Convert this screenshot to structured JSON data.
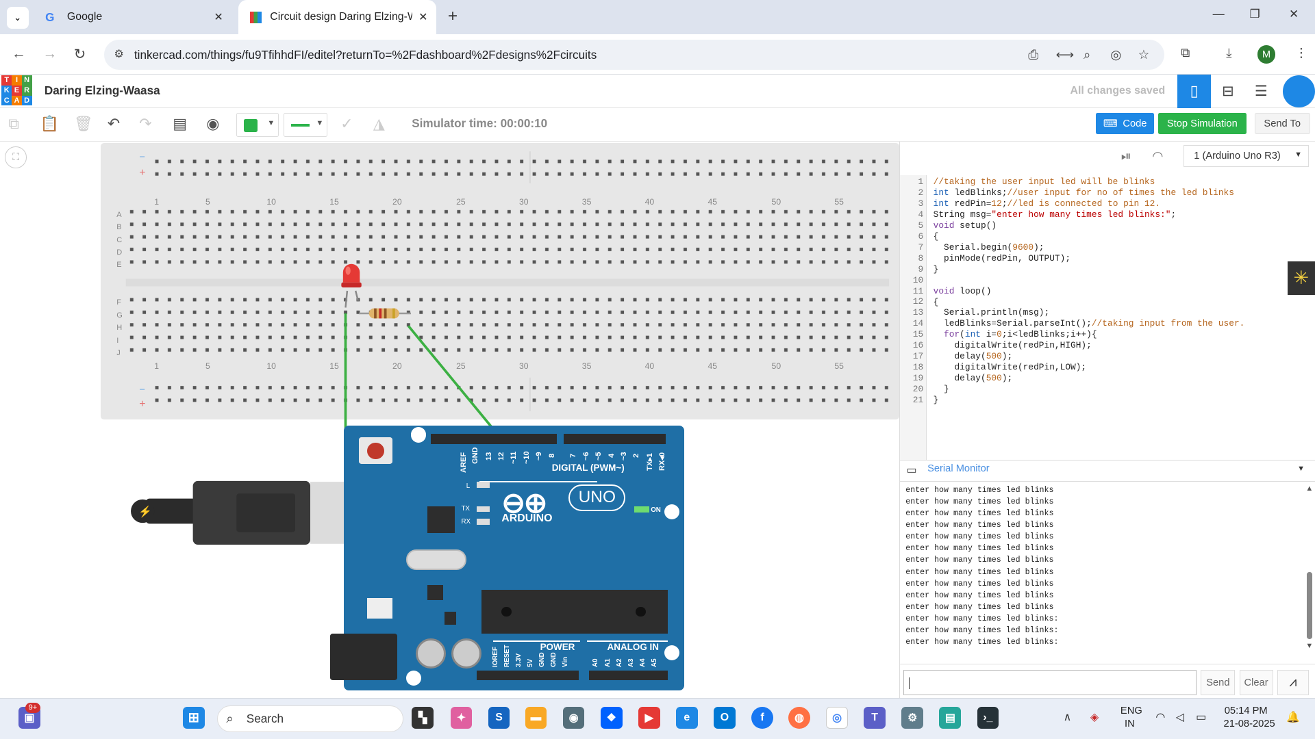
{
  "browser": {
    "tabs": [
      {
        "label": "Google"
      },
      {
        "label": "Circuit design Daring Elzing-Wa"
      }
    ],
    "url": "tinkercad.com/things/fu9TfihhdFI/editel?returnTo=%2Fdashboard%2Fdesigns%2Fcircuits",
    "profile_initial": "M"
  },
  "app": {
    "logo_letters": [
      "T",
      "I",
      "N",
      "K",
      "E",
      "R",
      "C",
      "A",
      "D"
    ],
    "title": "Daring Elzing-Waasa",
    "save_status": "All changes saved"
  },
  "toolbar": {
    "sim_time": "Simulator time: 00:00:10",
    "code_label": "Code",
    "stop_label": "Stop Simulation",
    "send_to_label": "Send To"
  },
  "code_panel": {
    "device": "1 (Arduino Uno R3)",
    "line_numbers": [
      "1",
      "2",
      "3",
      "4",
      "5",
      "6",
      "7",
      "8",
      "9",
      "10",
      "11",
      "12",
      "13",
      "14",
      "15",
      "16",
      "17",
      "18",
      "19",
      "20",
      "21"
    ],
    "lines": [
      "//taking the user input led will be blinks",
      "int ledBlinks;//user input for no of times the led blinks",
      "int redPin=12;//led is connected to pin 12.",
      "String msg=\"enter how many times led blinks:\";",
      "void setup()",
      "{",
      "  Serial.begin(9600);",
      "  pinMode(redPin, OUTPUT);",
      "}",
      "",
      "void loop()",
      "{",
      "  Serial.println(msg);",
      "  ledBlinks=Serial.parseInt();//taking input from the user.",
      "  for(int i=0;i<ledBlinks;i++){",
      "    digitalWrite(redPin,HIGH);",
      "    delay(500);",
      "    digitalWrite(redPin,LOW);",
      "    delay(500);",
      "  }",
      "}"
    ]
  },
  "serial_monitor": {
    "title": "Serial Monitor",
    "lines": [
      "enter how many times led blinks",
      "enter how many times led blinks",
      "enter how many times led blinks",
      "enter how many times led blinks",
      "enter how many times led blinks",
      "enter how many times led blinks",
      "enter how many times led blinks",
      "enter how many times led blinks",
      "enter how many times led blinks",
      "enter how many times led blinks",
      "enter how many times led blinks",
      "enter how many times led blinks:",
      "enter how many times led blinks:",
      "enter how many times led blinks:"
    ],
    "send_label": "Send",
    "clear_label": "Clear"
  },
  "breadboard": {
    "top_numbers": [
      "1",
      "5",
      "10",
      "15",
      "20",
      "25",
      "30",
      "35",
      "40",
      "45",
      "50",
      "55"
    ],
    "rows_top": [
      "A",
      "B",
      "C",
      "D",
      "E"
    ],
    "rows_bottom": [
      "F",
      "G",
      "H",
      "I",
      "J"
    ],
    "rail_minus": "−",
    "rail_plus": "+"
  },
  "arduino": {
    "brand": "ARDUINO",
    "model": "UNO",
    "digital_label": "DIGITAL (PWM~)",
    "power_label": "POWER",
    "analog_label": "ANALOG IN",
    "on_label": "ON",
    "l_label": "L",
    "tx_label": "TX",
    "rx_label": "RX",
    "top_pins": [
      "AREF",
      "GND",
      "13",
      "12",
      "~11",
      "~10",
      "~9",
      "8",
      "7",
      "~6",
      "~5",
      "4",
      "~3",
      "2",
      "TX▸1",
      "RX◂0"
    ],
    "bottom_pins": [
      "IOREF",
      "RESET",
      "3.3V",
      "5V",
      "GND",
      "GND",
      "Vin",
      "A0",
      "A1",
      "A2",
      "A3",
      "A4",
      "A5"
    ]
  },
  "taskbar": {
    "search_placeholder": "Search",
    "notification_badge": "9+",
    "lang": "ENG",
    "region": "IN",
    "time": "05:14 PM",
    "date": "21-08-2025"
  },
  "colors": {
    "accent_blue": "#1e88e5",
    "stop_green": "#2bb34a",
    "wire_green": "#3cb043",
    "arduino_blue": "#1f6fa6",
    "led_red": "#e53935"
  }
}
